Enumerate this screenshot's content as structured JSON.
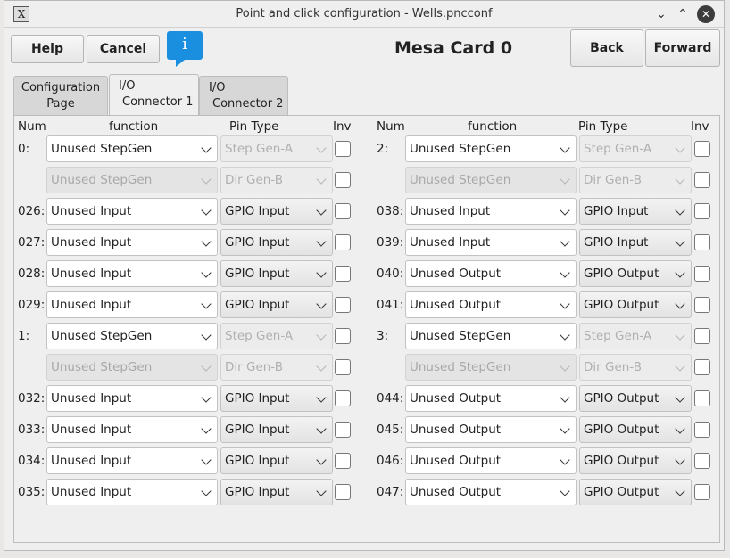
{
  "window": {
    "title": "Point and click configuration - Wells.pncconf"
  },
  "toolbar": {
    "help": "Help",
    "cancel": "Cancel",
    "info": "i",
    "card_title": "Mesa Card 0",
    "back": "Back",
    "forward": "Forward"
  },
  "tabs": [
    {
      "line1": "Configuration",
      "line2": "Page"
    },
    {
      "line1": "I/O",
      "line2": "Connector 1"
    },
    {
      "line1": "I/O",
      "line2": "Connector 2"
    }
  ],
  "headers": {
    "num": "Num",
    "function": "function",
    "pin_type": "Pin Type",
    "inv": "Inv"
  },
  "left_rows": [
    {
      "num": "0:",
      "func": "Unused StepGen",
      "type": "Step Gen-A",
      "func_disabled": false,
      "type_disabled": true
    },
    {
      "num": "",
      "func": "Unused StepGen",
      "type": "Dir Gen-B",
      "func_disabled": true,
      "type_disabled": true
    },
    {
      "num": "026:",
      "func": "Unused Input",
      "type": "GPIO Input",
      "func_disabled": false,
      "type_disabled": false
    },
    {
      "num": "027:",
      "func": "Unused Input",
      "type": "GPIO Input",
      "func_disabled": false,
      "type_disabled": false
    },
    {
      "num": "028:",
      "func": "Unused Input",
      "type": "GPIO Input",
      "func_disabled": false,
      "type_disabled": false
    },
    {
      "num": "029:",
      "func": "Unused Input",
      "type": "GPIO Input",
      "func_disabled": false,
      "type_disabled": false
    },
    {
      "num": "1:",
      "func": "Unused StepGen",
      "type": "Step Gen-A",
      "func_disabled": false,
      "type_disabled": true
    },
    {
      "num": "",
      "func": "Unused StepGen",
      "type": "Dir Gen-B",
      "func_disabled": true,
      "type_disabled": true
    },
    {
      "num": "032:",
      "func": "Unused Input",
      "type": "GPIO Input",
      "func_disabled": false,
      "type_disabled": false
    },
    {
      "num": "033:",
      "func": "Unused Input",
      "type": "GPIO Input",
      "func_disabled": false,
      "type_disabled": false
    },
    {
      "num": "034:",
      "func": "Unused Input",
      "type": "GPIO Input",
      "func_disabled": false,
      "type_disabled": false
    },
    {
      "num": "035:",
      "func": "Unused Input",
      "type": "GPIO Input",
      "func_disabled": false,
      "type_disabled": false
    }
  ],
  "right_rows": [
    {
      "num": "2:",
      "func": "Unused StepGen",
      "type": "Step Gen-A",
      "func_disabled": false,
      "type_disabled": true
    },
    {
      "num": "",
      "func": "Unused StepGen",
      "type": "Dir Gen-B",
      "func_disabled": true,
      "type_disabled": true
    },
    {
      "num": "038:",
      "func": "Unused Input",
      "type": "GPIO Input",
      "func_disabled": false,
      "type_disabled": false
    },
    {
      "num": "039:",
      "func": "Unused Input",
      "type": "GPIO Input",
      "func_disabled": false,
      "type_disabled": false
    },
    {
      "num": "040:",
      "func": "Unused Output",
      "type": "GPIO Output",
      "func_disabled": false,
      "type_disabled": false
    },
    {
      "num": "041:",
      "func": "Unused Output",
      "type": "GPIO Output",
      "func_disabled": false,
      "type_disabled": false
    },
    {
      "num": "3:",
      "func": "Unused StepGen",
      "type": "Step Gen-A",
      "func_disabled": false,
      "type_disabled": true
    },
    {
      "num": "",
      "func": "Unused StepGen",
      "type": "Dir Gen-B",
      "func_disabled": true,
      "type_disabled": true
    },
    {
      "num": "044:",
      "func": "Unused Output",
      "type": "GPIO Output",
      "func_disabled": false,
      "type_disabled": false
    },
    {
      "num": "045:",
      "func": "Unused Output",
      "type": "GPIO Output",
      "func_disabled": false,
      "type_disabled": false
    },
    {
      "num": "046:",
      "func": "Unused Output",
      "type": "GPIO Output",
      "func_disabled": false,
      "type_disabled": false
    },
    {
      "num": "047:",
      "func": "Unused Output",
      "type": "GPIO Output",
      "func_disabled": false,
      "type_disabled": false
    }
  ]
}
